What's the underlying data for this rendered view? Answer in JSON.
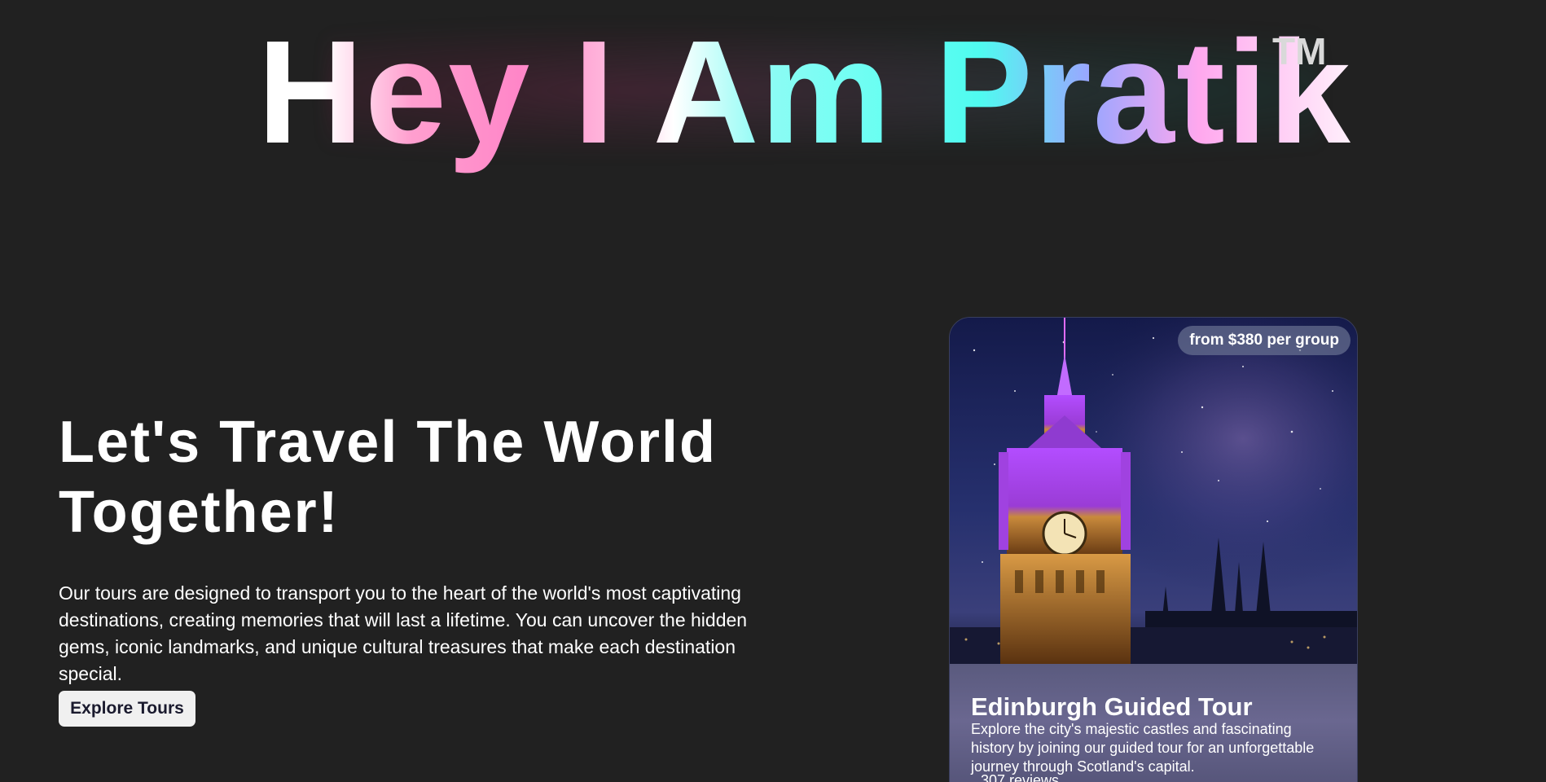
{
  "brand": {
    "title": "Hey I Am Pratik",
    "trademark": "TM"
  },
  "hero": {
    "heading": "Let's Travel The World Together!",
    "description": "Our tours are designed to transport you to the heart of the world's most captivating destinations, creating memories that will last a lifetime. You can uncover the hidden gems, iconic landmarks, and unique cultural treasures that make each destination special.",
    "cta_label": "Explore Tours"
  },
  "tour_card": {
    "price_badge": "from $380 per group",
    "title": "Edinburgh Guided Tour",
    "description": "Explore the city's majestic castles and fascinating history by joining our guided tour for an unforgettable journey through Scotland's capital.",
    "reviews": "307 reviews"
  },
  "colors": {
    "page_background": "#212121",
    "button_background": "#f0f0f0",
    "button_text": "#1a1a2e",
    "gradient_pink": "#ff86c8",
    "gradient_cyan": "#4ffbf0",
    "gradient_violet": "#9aa6ff"
  }
}
